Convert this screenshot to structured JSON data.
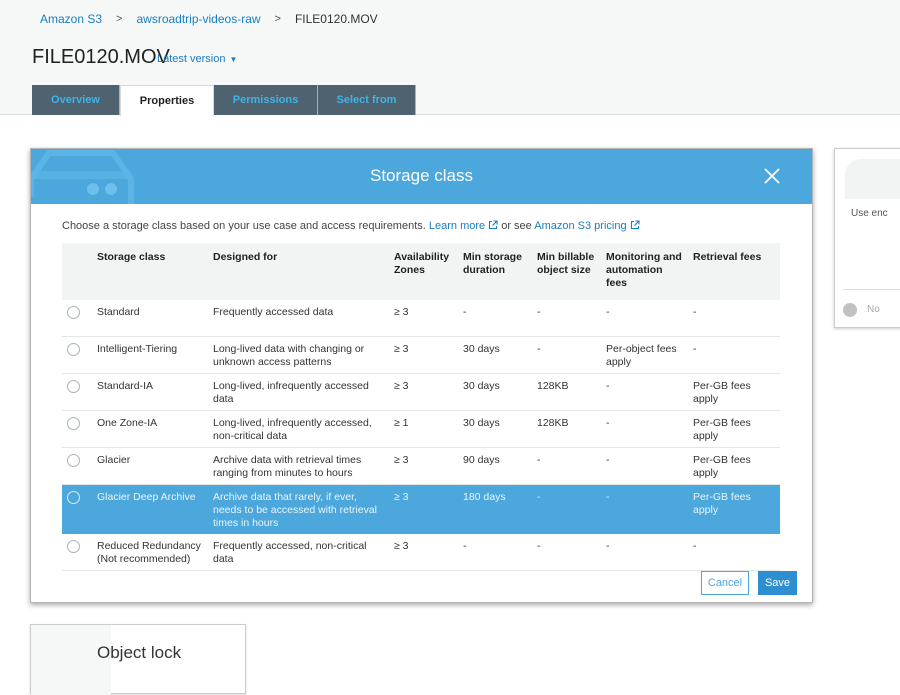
{
  "breadcrumb": [
    {
      "label": "Amazon S3"
    },
    {
      "label": "awsroadtrip-videos-raw"
    },
    {
      "label": "FILE0120.MOV"
    }
  ],
  "breadcrumb_separator": ">",
  "page": {
    "title": "FILE0120.MOV",
    "version_label": "Latest version"
  },
  "tabs": [
    {
      "label": "Overview",
      "active": false
    },
    {
      "label": "Properties",
      "active": true
    },
    {
      "label": "Permissions",
      "active": false
    },
    {
      "label": "Select from",
      "active": false
    }
  ],
  "side_card": {
    "text": "Use enc",
    "option": "No"
  },
  "object_lock": {
    "label": "Object lock"
  },
  "modal": {
    "title": "Storage class",
    "intro": "Choose a storage class based on your use case and access requirements.",
    "learn_more": "Learn more",
    "or_see": "or see",
    "pricing_link": "Amazon S3 pricing",
    "columns": [
      "",
      "Storage class",
      "Designed for",
      "Availability Zones",
      "Min storage duration",
      "Min billable object size",
      "Monitoring and automation fees",
      "Retrieval fees"
    ],
    "rows": [
      {
        "name": "Standard",
        "designed_for": "Frequently accessed data",
        "az": "≥ 3",
        "min_duration": "-",
        "min_size": "-",
        "monitoring": "-",
        "retrieval": "-",
        "selected": false
      },
      {
        "name": "Intelligent-Tiering",
        "designed_for": "Long-lived data with changing or unknown access patterns",
        "az": "≥ 3",
        "min_duration": "30 days",
        "min_size": "-",
        "monitoring": "Per-object fees apply",
        "retrieval": "-",
        "selected": false
      },
      {
        "name": "Standard-IA",
        "designed_for": "Long-lived, infrequently accessed data",
        "az": "≥ 3",
        "min_duration": "30 days",
        "min_size": "128KB",
        "monitoring": "-",
        "retrieval": "Per-GB fees apply",
        "selected": false
      },
      {
        "name": "One Zone-IA",
        "designed_for": "Long-lived, infrequently accessed, non-critical data",
        "az": "≥ 1",
        "min_duration": "30 days",
        "min_size": "128KB",
        "monitoring": "-",
        "retrieval": "Per-GB fees apply",
        "selected": false
      },
      {
        "name": "Glacier",
        "designed_for": "Archive data with retrieval times ranging from minutes to hours",
        "az": "≥ 3",
        "min_duration": "90 days",
        "min_size": "-",
        "monitoring": "-",
        "retrieval": "Per-GB fees apply",
        "selected": false
      },
      {
        "name": "Glacier Deep Archive",
        "designed_for": "Archive data that rarely, if ever, needs to be accessed with retrieval times in hours",
        "az": "≥ 3",
        "min_duration": "180 days",
        "min_size": "-",
        "monitoring": "-",
        "retrieval": "Per-GB fees apply",
        "selected": true
      },
      {
        "name": "Reduced Redundancy (Not recommended)",
        "designed_for": "Frequently accessed, non-critical data",
        "az": "≥ 3",
        "min_duration": "-",
        "min_size": "-",
        "monitoring": "-",
        "retrieval": "-",
        "selected": false
      }
    ],
    "cancel_label": "Cancel",
    "save_label": "Save"
  },
  "colors": {
    "accent": "#4ba7dc",
    "link": "#1a7ec1",
    "tab_bg": "#4f6270",
    "tab_text": "#3fb3e6",
    "save_bg": "#2e8fd0"
  }
}
